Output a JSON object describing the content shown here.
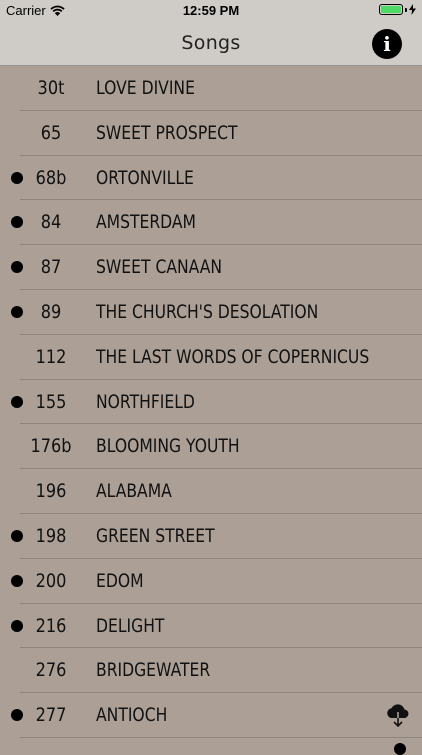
{
  "status_bar": {
    "carrier": "Carrier",
    "time": "12:59 PM",
    "battery_level": 1.0
  },
  "navbar": {
    "title": "Songs",
    "info_label": "i"
  },
  "songs": [
    {
      "number": "30t",
      "name": "LOVE DIVINE",
      "marked": false
    },
    {
      "number": "65",
      "name": "SWEET PROSPECT",
      "marked": false
    },
    {
      "number": "68b",
      "name": "ORTONVILLE",
      "marked": true
    },
    {
      "number": "84",
      "name": "AMSTERDAM",
      "marked": true
    },
    {
      "number": "87",
      "name": "SWEET CANAAN",
      "marked": true
    },
    {
      "number": "89",
      "name": "THE CHURCH'S DESOLATION",
      "marked": true
    },
    {
      "number": "112",
      "name": "THE LAST WORDS OF COPERNICUS",
      "marked": false
    },
    {
      "number": "155",
      "name": "NORTHFIELD",
      "marked": true
    },
    {
      "number": "176b",
      "name": "BLOOMING YOUTH",
      "marked": false
    },
    {
      "number": "196",
      "name": "ALABAMA",
      "marked": false
    },
    {
      "number": "198",
      "name": "GREEN STREET",
      "marked": true
    },
    {
      "number": "200",
      "name": "EDOM",
      "marked": true
    },
    {
      "number": "216",
      "name": "DELIGHT",
      "marked": true
    },
    {
      "number": "276",
      "name": "BRIDGEWATER",
      "marked": false
    },
    {
      "number": "277",
      "name": "ANTIOCH",
      "marked": true,
      "download_icon": "cloud-download-icon"
    }
  ]
}
